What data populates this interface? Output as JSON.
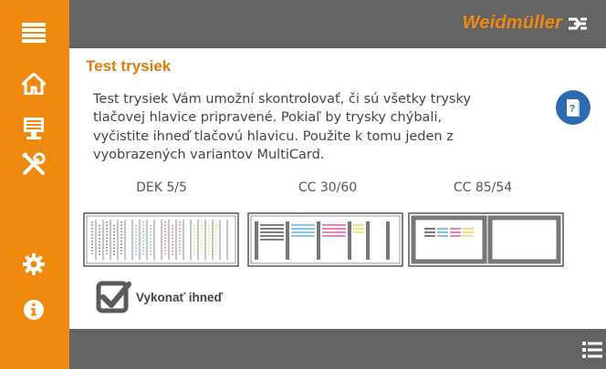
{
  "header": {
    "brand": "Weidmüller"
  },
  "page": {
    "title": "Test trysiek",
    "description": "Test trysiek Vám umožní skontrolovať, či sú všetky trysky tlačovej hlavice pripravené. Pokiaľ by trysky chýbali, vyčistite ihneď tlačovú hlavicu. Použite k tomu jeden z vyobrazených variantov MultiCard."
  },
  "cards": [
    {
      "label": "DEK 5/5"
    },
    {
      "label": "CC 30/60"
    },
    {
      "label": "CC 85/54"
    }
  ],
  "checkbox": {
    "label": "Vykonať ihneď",
    "checked": true
  },
  "colors": {
    "accent": "#ef8a0e",
    "bar": "#646466",
    "help": "#2d6bb0"
  }
}
